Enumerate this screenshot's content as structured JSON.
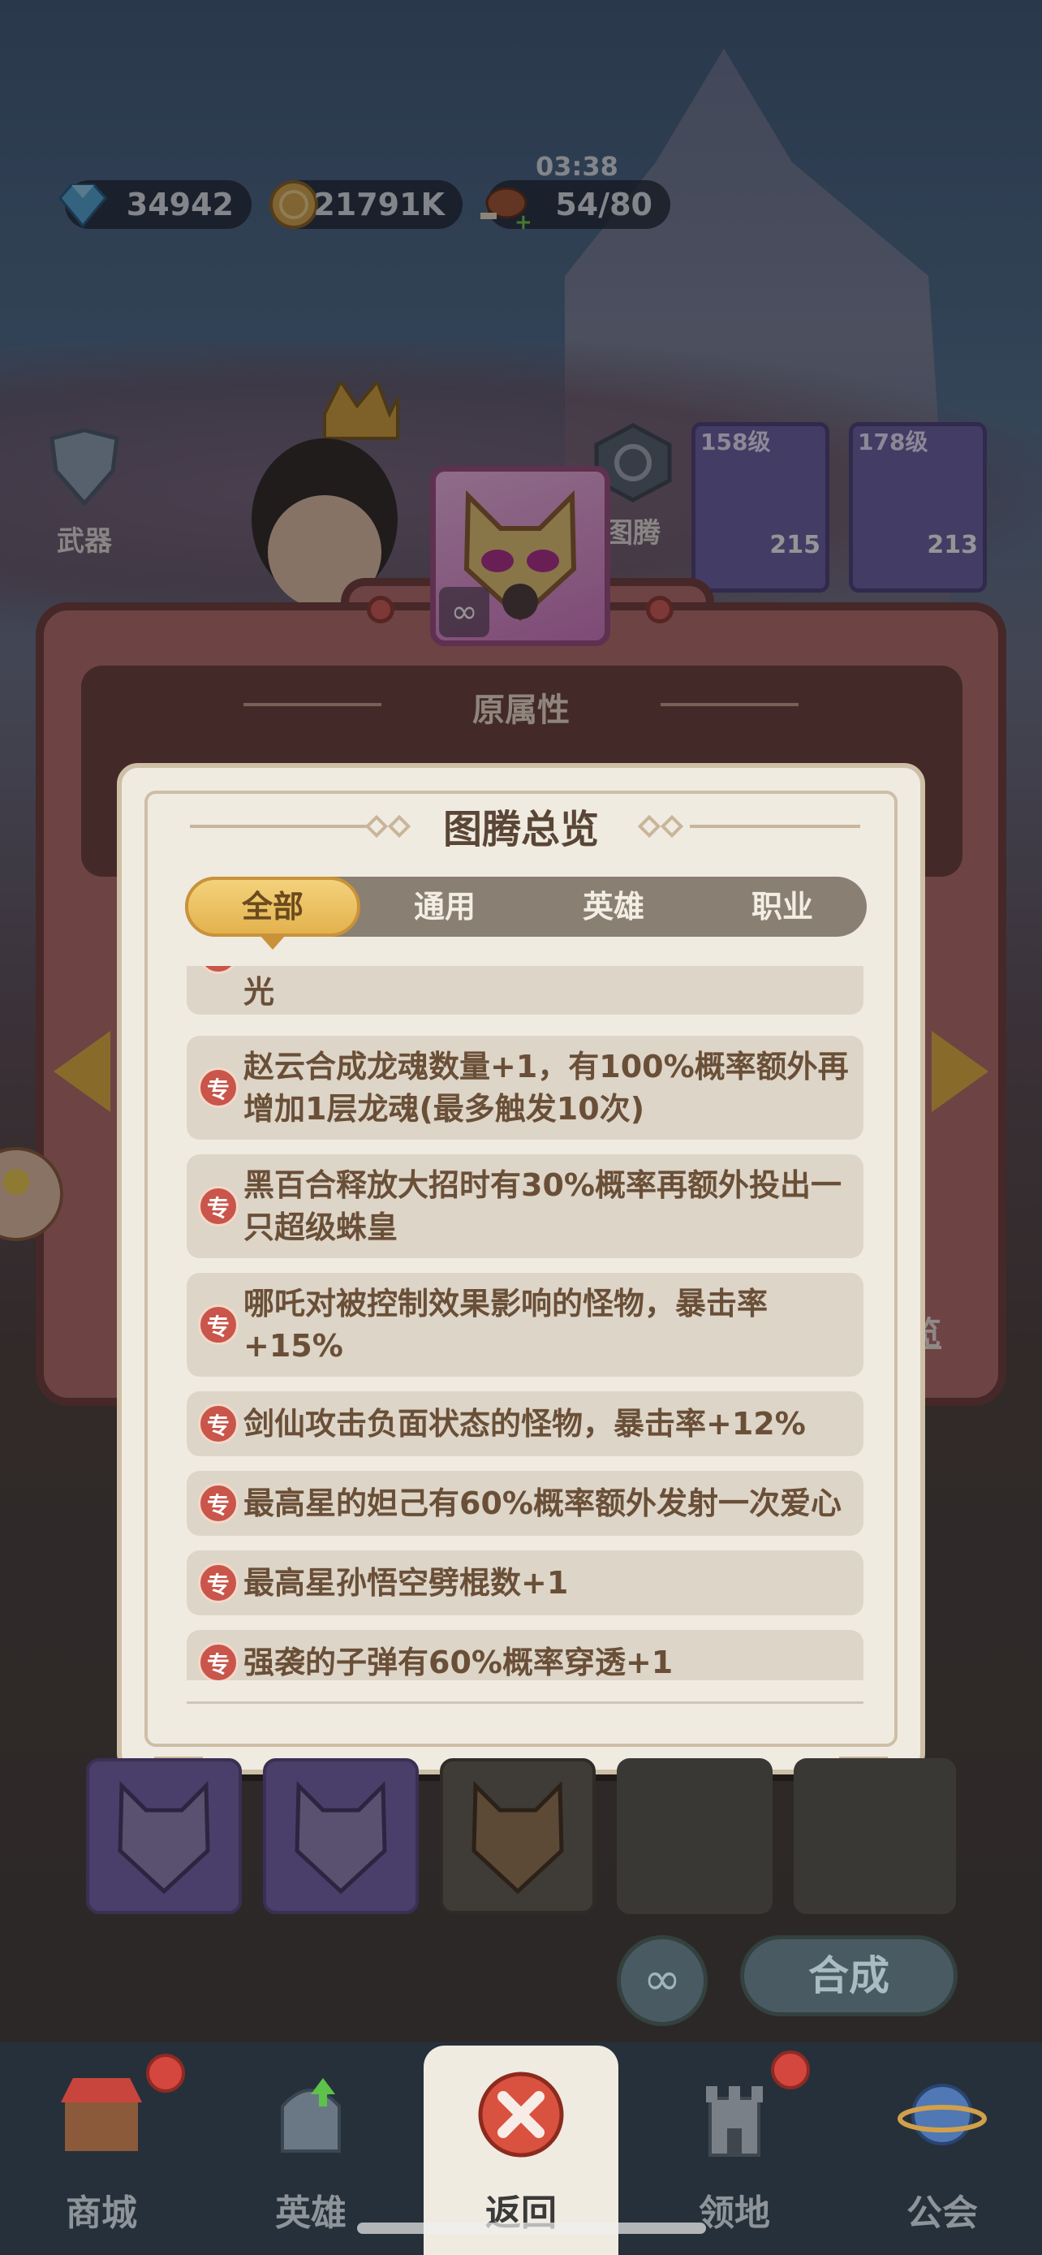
{
  "status": {
    "timer": "03:38",
    "gems": "34942",
    "coins": "21791K",
    "stamina": "54/80"
  },
  "background": {
    "weapon_label": "武器",
    "totem_label": "图腾",
    "hero_cards": [
      {
        "level": "158级",
        "number": "215"
      },
      {
        "level": "178级",
        "number": "213"
      }
    ],
    "overview_link": "览"
  },
  "outer_panel": {
    "title": "原属性"
  },
  "modal": {
    "title": "图腾总览",
    "tabs": [
      {
        "label": "全部",
        "active": true
      },
      {
        "label": "通用",
        "active": false
      },
      {
        "label": "英雄",
        "active": false
      },
      {
        "label": "职业",
        "active": false
      }
    ],
    "item_icon_char": "专",
    "items": [
      {
        "text": "光"
      },
      {
        "text": "赵云合成龙魂数量+1，有100%概率额外再增加1层龙魂(最多触发10次)"
      },
      {
        "text": "黑百合释放大招时有30%概率再额外投出一只超级蛛皇"
      },
      {
        "text": "哪吒对被控制效果影响的怪物，暴击率+15%"
      },
      {
        "text": "剑仙攻击负面状态的怪物，暴击率+12%"
      },
      {
        "text": "最高星的妲己有60%概率额外发射一次爱心"
      },
      {
        "text": "最高星孙悟空劈棍数+1"
      },
      {
        "text": "强袭的子弹有60%概率穿透+1"
      }
    ]
  },
  "actions": {
    "synthesize_label": "合成"
  },
  "nav": {
    "items": [
      {
        "label": "商城",
        "active": false,
        "badge": true
      },
      {
        "label": "英雄",
        "active": false,
        "badge": false
      },
      {
        "label": "返回",
        "active": true,
        "badge": false
      },
      {
        "label": "领地",
        "active": false,
        "badge": true
      },
      {
        "label": "公会",
        "active": false,
        "badge": false
      }
    ]
  },
  "colors": {
    "modal_bg": "#f0ebe1",
    "tab_active": "#e3b24e",
    "item_bg": "#ddd5c7",
    "item_icon": "#c9554b",
    "panel": "#b96c6a"
  }
}
